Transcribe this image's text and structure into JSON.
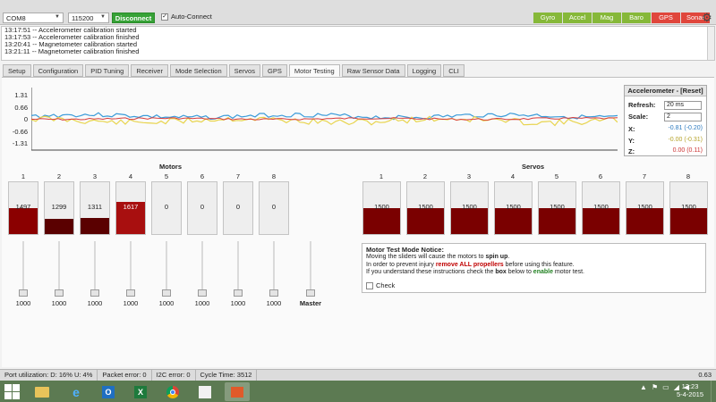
{
  "header": {
    "port": "COM8",
    "baud": "115200",
    "disconnect_label": "Disconnect",
    "auto_connect_label": "Auto-Connect",
    "sensors": [
      {
        "label": "Gyro",
        "color": "#86b839"
      },
      {
        "label": "Accel",
        "color": "#86b839"
      },
      {
        "label": "Mag",
        "color": "#86b839"
      },
      {
        "label": "Baro",
        "color": "#86b839"
      },
      {
        "label": "GPS",
        "color": "#e0463c"
      },
      {
        "label": "Sonar",
        "color": "#e0463c"
      }
    ]
  },
  "log": [
    "13:17:51 -- Accelerometer calibration started",
    "13:17:53 -- Accelerometer calibration finished",
    "13:20:41 -- Magnetometer calibration started",
    "13:21:11 -- Magnetometer calibration finished"
  ],
  "tabs": [
    "Setup",
    "Configuration",
    "PID Tuning",
    "Receiver",
    "Mode Selection",
    "Servos",
    "GPS",
    "Motor Testing",
    "Raw Sensor Data",
    "Logging",
    "CLI"
  ],
  "active_tab": "Motor Testing",
  "graph": {
    "y_ticks": [
      "1.31",
      "0.66",
      "0",
      "-0.66",
      "-1.31"
    ],
    "series_colors": [
      "#3a9bd9",
      "#e8d44d",
      "#d83b3b"
    ]
  },
  "accel_panel": {
    "title": "Accelerometer - [Reset]",
    "refresh_label": "Refresh:",
    "refresh_value": "20 ms",
    "scale_label": "Scale:",
    "scale_value": "2",
    "x_label": "X:",
    "x_value": "-0.81 (-0.20)",
    "x_color": "#2e7bbf",
    "y_label": "Y:",
    "y_value": "-0.00 (-0.31)",
    "y_color": "#b5a22a",
    "z_label": "Z:",
    "z_value": "0.00 (0.11)",
    "z_color": "#c33"
  },
  "motors": {
    "title": "Motors",
    "items": [
      {
        "index": "1",
        "value": "1497",
        "level": 0.5
      },
      {
        "index": "2",
        "value": "1299",
        "level": 0.3
      },
      {
        "index": "3",
        "value": "1311",
        "level": 0.31
      },
      {
        "index": "4",
        "value": "1617",
        "level": 0.62
      },
      {
        "index": "5",
        "value": "0",
        "level": 0
      },
      {
        "index": "6",
        "value": "0",
        "level": 0
      },
      {
        "index": "7",
        "value": "0",
        "level": 0
      },
      {
        "index": "8",
        "value": "0",
        "level": 0
      }
    ],
    "slider_values": [
      "1000",
      "1000",
      "1000",
      "1000",
      "1000",
      "1000",
      "1000",
      "1000"
    ],
    "master_label": "Master",
    "bar_color": "#8b0000"
  },
  "servos": {
    "title": "Servos",
    "items": [
      {
        "index": "1",
        "value": "1500",
        "level": 0.5
      },
      {
        "index": "2",
        "value": "1500",
        "level": 0.5
      },
      {
        "index": "3",
        "value": "1500",
        "level": 0.5
      },
      {
        "index": "4",
        "value": "1500",
        "level": 0.5
      },
      {
        "index": "5",
        "value": "1500",
        "level": 0.5
      },
      {
        "index": "6",
        "value": "1500",
        "level": 0.5
      },
      {
        "index": "7",
        "value": "1500",
        "level": 0.5
      },
      {
        "index": "8",
        "value": "1500",
        "level": 0.5
      }
    ]
  },
  "notice": {
    "title": "Motor Test Mode Notice:",
    "line1_a": "Moving the sliders will cause the motors to ",
    "line1_b": "spin up",
    "line1_c": ".",
    "line2_a": "In order to prevent injury ",
    "line2_b": "remove ALL propellers",
    "line2_c": " before using this feature.",
    "line3_a": "If you understand these instructions check the ",
    "line3_b": "box",
    "line3_c": " below to ",
    "line3_d": "enable",
    "line3_e": " motor test.",
    "check_label": "Check"
  },
  "status": {
    "port_util": "Port utilization: D: 16% U: 4%",
    "packet_error": "Packet error: 0",
    "i2c_error": "I2C error: 0",
    "cycle_time": "Cycle Time: 3512",
    "version": "0.63"
  },
  "taskbar": {
    "time": "13:23",
    "date": "5-4-2015"
  }
}
